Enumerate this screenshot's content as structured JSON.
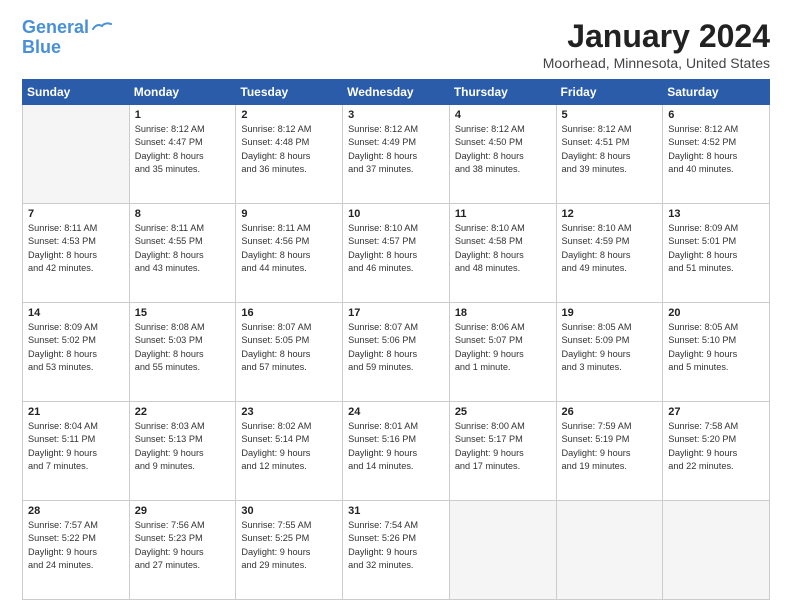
{
  "header": {
    "logo_line1": "General",
    "logo_line2": "Blue",
    "month": "January 2024",
    "location": "Moorhead, Minnesota, United States"
  },
  "weekdays": [
    "Sunday",
    "Monday",
    "Tuesday",
    "Wednesday",
    "Thursday",
    "Friday",
    "Saturday"
  ],
  "weeks": [
    [
      {
        "day": "",
        "info": ""
      },
      {
        "day": "1",
        "info": "Sunrise: 8:12 AM\nSunset: 4:47 PM\nDaylight: 8 hours\nand 35 minutes."
      },
      {
        "day": "2",
        "info": "Sunrise: 8:12 AM\nSunset: 4:48 PM\nDaylight: 8 hours\nand 36 minutes."
      },
      {
        "day": "3",
        "info": "Sunrise: 8:12 AM\nSunset: 4:49 PM\nDaylight: 8 hours\nand 37 minutes."
      },
      {
        "day": "4",
        "info": "Sunrise: 8:12 AM\nSunset: 4:50 PM\nDaylight: 8 hours\nand 38 minutes."
      },
      {
        "day": "5",
        "info": "Sunrise: 8:12 AM\nSunset: 4:51 PM\nDaylight: 8 hours\nand 39 minutes."
      },
      {
        "day": "6",
        "info": "Sunrise: 8:12 AM\nSunset: 4:52 PM\nDaylight: 8 hours\nand 40 minutes."
      }
    ],
    [
      {
        "day": "7",
        "info": "Sunrise: 8:11 AM\nSunset: 4:53 PM\nDaylight: 8 hours\nand 42 minutes."
      },
      {
        "day": "8",
        "info": "Sunrise: 8:11 AM\nSunset: 4:55 PM\nDaylight: 8 hours\nand 43 minutes."
      },
      {
        "day": "9",
        "info": "Sunrise: 8:11 AM\nSunset: 4:56 PM\nDaylight: 8 hours\nand 44 minutes."
      },
      {
        "day": "10",
        "info": "Sunrise: 8:10 AM\nSunset: 4:57 PM\nDaylight: 8 hours\nand 46 minutes."
      },
      {
        "day": "11",
        "info": "Sunrise: 8:10 AM\nSunset: 4:58 PM\nDaylight: 8 hours\nand 48 minutes."
      },
      {
        "day": "12",
        "info": "Sunrise: 8:10 AM\nSunset: 4:59 PM\nDaylight: 8 hours\nand 49 minutes."
      },
      {
        "day": "13",
        "info": "Sunrise: 8:09 AM\nSunset: 5:01 PM\nDaylight: 8 hours\nand 51 minutes."
      }
    ],
    [
      {
        "day": "14",
        "info": "Sunrise: 8:09 AM\nSunset: 5:02 PM\nDaylight: 8 hours\nand 53 minutes."
      },
      {
        "day": "15",
        "info": "Sunrise: 8:08 AM\nSunset: 5:03 PM\nDaylight: 8 hours\nand 55 minutes."
      },
      {
        "day": "16",
        "info": "Sunrise: 8:07 AM\nSunset: 5:05 PM\nDaylight: 8 hours\nand 57 minutes."
      },
      {
        "day": "17",
        "info": "Sunrise: 8:07 AM\nSunset: 5:06 PM\nDaylight: 8 hours\nand 59 minutes."
      },
      {
        "day": "18",
        "info": "Sunrise: 8:06 AM\nSunset: 5:07 PM\nDaylight: 9 hours\nand 1 minute."
      },
      {
        "day": "19",
        "info": "Sunrise: 8:05 AM\nSunset: 5:09 PM\nDaylight: 9 hours\nand 3 minutes."
      },
      {
        "day": "20",
        "info": "Sunrise: 8:05 AM\nSunset: 5:10 PM\nDaylight: 9 hours\nand 5 minutes."
      }
    ],
    [
      {
        "day": "21",
        "info": "Sunrise: 8:04 AM\nSunset: 5:11 PM\nDaylight: 9 hours\nand 7 minutes."
      },
      {
        "day": "22",
        "info": "Sunrise: 8:03 AM\nSunset: 5:13 PM\nDaylight: 9 hours\nand 9 minutes."
      },
      {
        "day": "23",
        "info": "Sunrise: 8:02 AM\nSunset: 5:14 PM\nDaylight: 9 hours\nand 12 minutes."
      },
      {
        "day": "24",
        "info": "Sunrise: 8:01 AM\nSunset: 5:16 PM\nDaylight: 9 hours\nand 14 minutes."
      },
      {
        "day": "25",
        "info": "Sunrise: 8:00 AM\nSunset: 5:17 PM\nDaylight: 9 hours\nand 17 minutes."
      },
      {
        "day": "26",
        "info": "Sunrise: 7:59 AM\nSunset: 5:19 PM\nDaylight: 9 hours\nand 19 minutes."
      },
      {
        "day": "27",
        "info": "Sunrise: 7:58 AM\nSunset: 5:20 PM\nDaylight: 9 hours\nand 22 minutes."
      }
    ],
    [
      {
        "day": "28",
        "info": "Sunrise: 7:57 AM\nSunset: 5:22 PM\nDaylight: 9 hours\nand 24 minutes."
      },
      {
        "day": "29",
        "info": "Sunrise: 7:56 AM\nSunset: 5:23 PM\nDaylight: 9 hours\nand 27 minutes."
      },
      {
        "day": "30",
        "info": "Sunrise: 7:55 AM\nSunset: 5:25 PM\nDaylight: 9 hours\nand 29 minutes."
      },
      {
        "day": "31",
        "info": "Sunrise: 7:54 AM\nSunset: 5:26 PM\nDaylight: 9 hours\nand 32 minutes."
      },
      {
        "day": "",
        "info": ""
      },
      {
        "day": "",
        "info": ""
      },
      {
        "day": "",
        "info": ""
      }
    ]
  ]
}
